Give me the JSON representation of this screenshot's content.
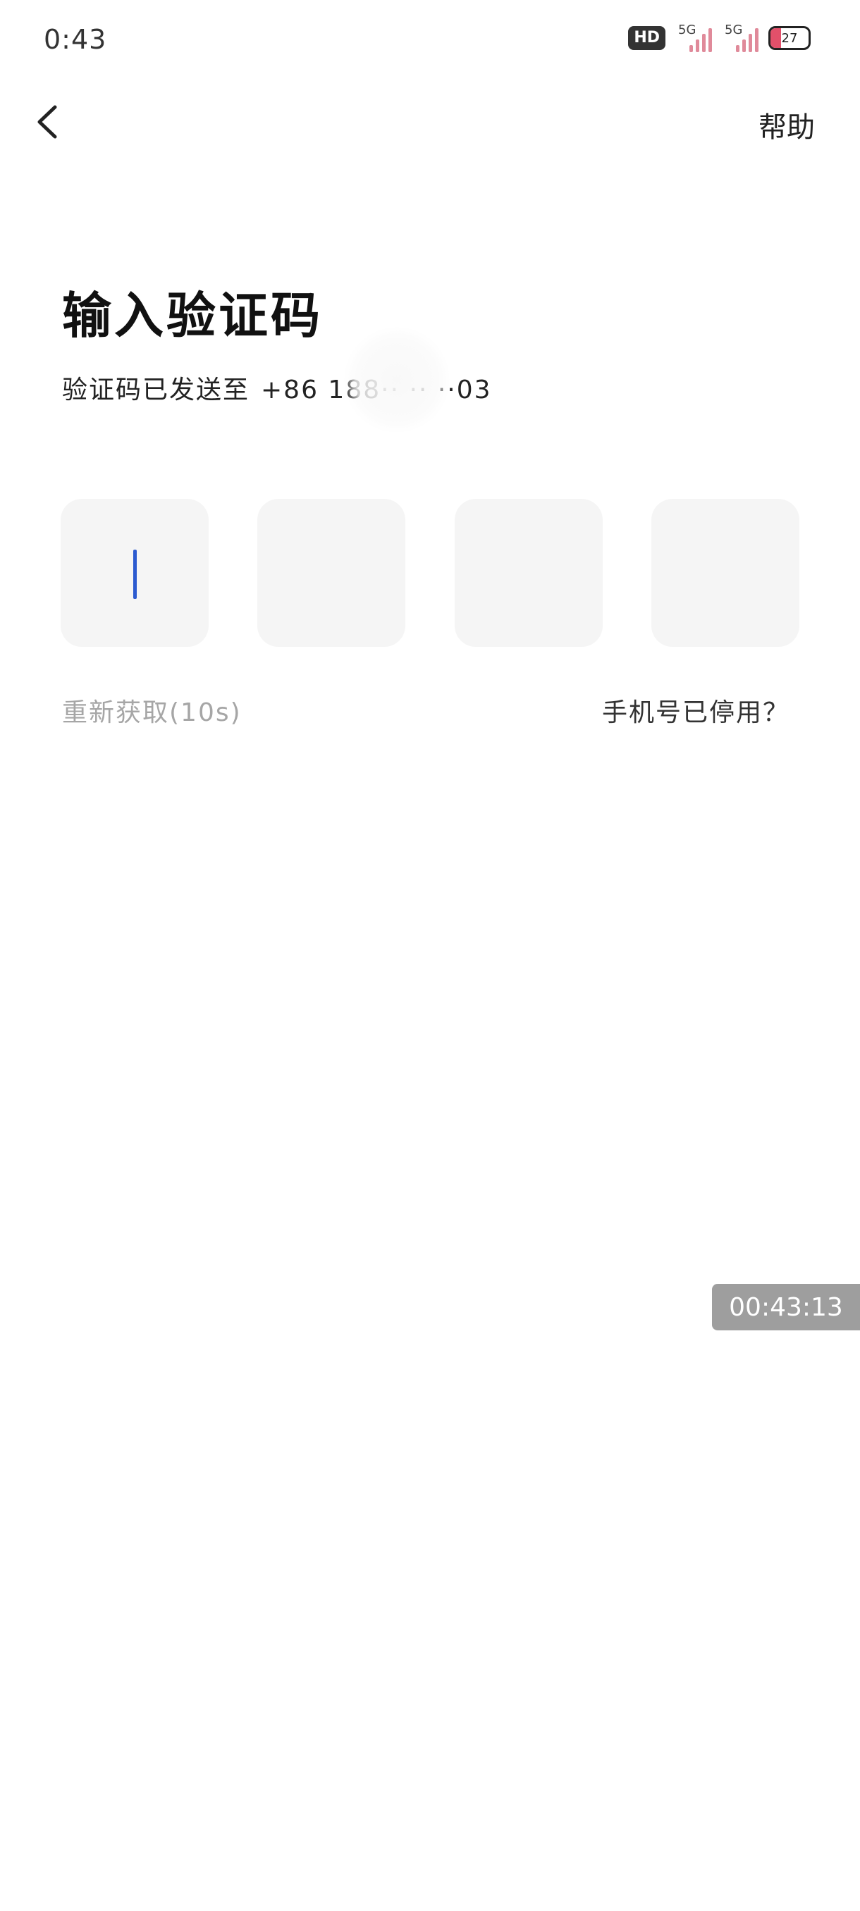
{
  "status_bar": {
    "time": "0:43",
    "hd_label": "HD",
    "signal1_label": "5G",
    "signal2_label": "5G",
    "battery_level": "27"
  },
  "nav": {
    "help_label": "帮助"
  },
  "main": {
    "title": "输入验证码",
    "sent_prefix": "验证码已发送至",
    "phone_number": "+86 188·· ·· ··03",
    "code_boxes": [
      "",
      "",
      "",
      ""
    ],
    "resend_label": "重新获取(10s)",
    "disabled_phone_label": "手机号已停用？"
  },
  "overlay": {
    "timer": "00:43:13"
  },
  "colors": {
    "cursor": "#2c5bd0",
    "code_box_bg": "#f5f5f5",
    "muted_text": "#a6a6a6",
    "battery_fill": "#e2506a"
  }
}
